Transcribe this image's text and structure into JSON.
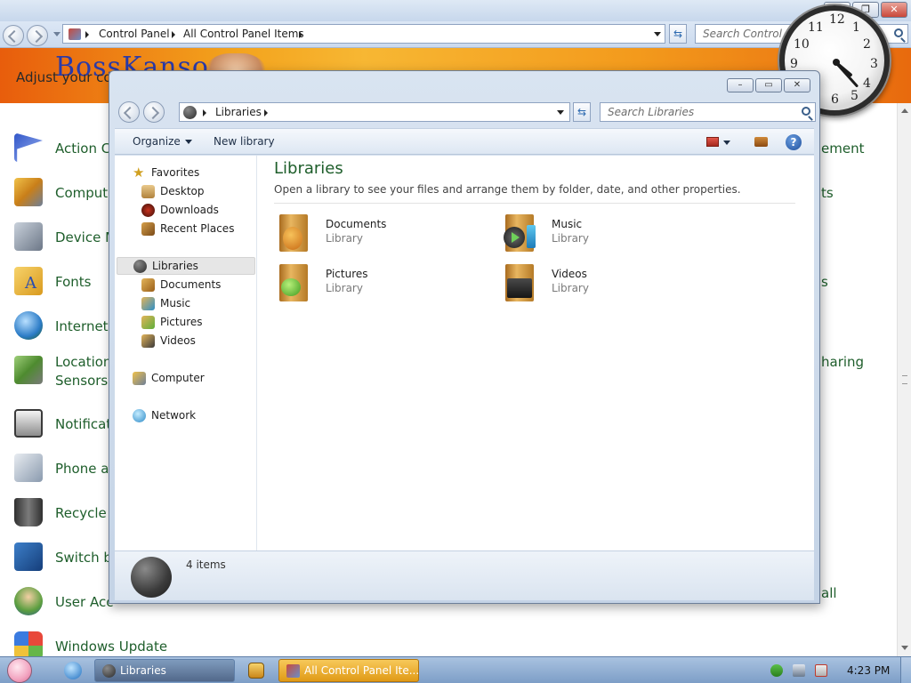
{
  "control_panel": {
    "breadcrumb": [
      "Control Panel",
      "All Control Panel Items"
    ],
    "search_placeholder": "Search Control Panel",
    "banner_logo": "BossKanso",
    "banner_text": "Adjust your co",
    "items_left": [
      {
        "label": "Action Ce",
        "icon": "flag-icon"
      },
      {
        "label": "Compute",
        "icon": "computer-icon"
      },
      {
        "label": "Device M",
        "icon": "device-manager-icon"
      },
      {
        "label": "Fonts",
        "icon": "fonts-folder-icon"
      },
      {
        "label": "Internet (",
        "icon": "internet-options-icon"
      },
      {
        "label": "Location",
        "label2": "Sensors",
        "icon": "location-sensors-icon"
      },
      {
        "label": "Notificati",
        "icon": "notification-icon"
      },
      {
        "label": "Phone ar",
        "icon": "phone-icon"
      },
      {
        "label": "Recycle E",
        "icon": "recycle-bin-icon"
      },
      {
        "label": "Switch b",
        "icon": "switch-user-icon"
      },
      {
        "label": "User Acc",
        "icon": "user-accounts-icon"
      },
      {
        "label": "Windows Update",
        "icon": "windows-update-icon"
      }
    ],
    "items_right": [
      "ement",
      "ts",
      "s",
      "haring",
      "all"
    ]
  },
  "clock": {
    "time": "4:23",
    "numbers": [
      "12",
      "1",
      "2",
      "3",
      "4",
      "5",
      "6",
      "9",
      "10",
      "11"
    ]
  },
  "libraries_window": {
    "address": "Libraries",
    "search_placeholder": "Search Libraries",
    "toolbar": {
      "organize": "Organize",
      "new_library": "New library"
    },
    "nav_tree": {
      "favorites": {
        "label": "Favorites",
        "children": [
          "Desktop",
          "Downloads",
          "Recent Places"
        ]
      },
      "libraries": {
        "label": "Libraries",
        "children": [
          "Documents",
          "Music",
          "Pictures",
          "Videos"
        ]
      },
      "computer": "Computer",
      "network": "Network"
    },
    "heading": "Libraries",
    "subtitle": "Open a library to see your files and arrange them by folder, date, and other properties.",
    "libraries": [
      {
        "name": "Documents",
        "type": "Library",
        "icon": "documents-library-icon"
      },
      {
        "name": "Music",
        "type": "Library",
        "icon": "music-library-icon"
      },
      {
        "name": "Pictures",
        "type": "Library",
        "icon": "pictures-library-icon"
      },
      {
        "name": "Videos",
        "type": "Library",
        "icon": "videos-library-icon"
      }
    ],
    "status": "4 items"
  },
  "taskbar": {
    "buttons": [
      {
        "label": "Libraries"
      },
      {
        "label": "All Control Panel Ite..."
      }
    ],
    "time": "4:23 PM"
  },
  "colors": {
    "accent_green": "#1e5e2b",
    "banner_orange": "#f3a21c",
    "taskbar_blue": "#7d9ec7",
    "active_task": "#f0b028"
  }
}
